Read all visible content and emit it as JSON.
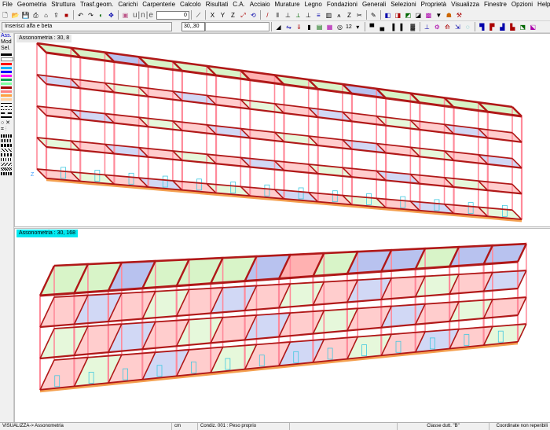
{
  "menu": [
    "File",
    "Geometria",
    "Struttura",
    "Trasf.geom.",
    "Carichi",
    "Carpenterie",
    "Calcolo",
    "Risultati",
    "C.A.",
    "Acciaio",
    "Murature",
    "Legno",
    "Fondazioni",
    "Generali",
    "Selezioni",
    "Proprietà",
    "Visualizza",
    "Finestre",
    "Opzioni",
    "Help"
  ],
  "toolbar": {
    "ortho_label": "u|n|e",
    "count_value": "0",
    "prompt_label": "Inserisci alfa e beta",
    "prompt_value": "30,,30",
    "line_weight_value": "12"
  },
  "left_panel": {
    "ass_label": "Ass.",
    "mod_label": "Mod",
    "sel_label": "Sel.",
    "colors": [
      "#000000",
      "#ffffff",
      "#ff0000",
      "#00b4ff",
      "#0000ff",
      "#ff00ff",
      "#00a050",
      "#80ffa0",
      "#a00000",
      "#ff8080",
      "#ffa040",
      "#ffd0a0"
    ]
  },
  "views": {
    "top": {
      "label": "Assonometria : 30, 8",
      "axis": "Z"
    },
    "bottom": {
      "label": "Assonometria : 30, 168"
    }
  },
  "status": {
    "mode": "VISUALIZZA-> Assonometria",
    "unit": "cm",
    "condition": "Condiz. 001 : Peso proprio",
    "ductility": "Classe dutt. \"B\"",
    "coords": "Coordinate non reperibili"
  },
  "style": {
    "beam_red": "#b01818",
    "frame_pink": "#ff8a9a",
    "slab_green": "#c8f0b0",
    "slab_blue": "#9aa8e8",
    "slab_red": "#ff9090",
    "base_orange": "#f4a050",
    "cyan_line": "#40c8e0",
    "active_label": "#00e8f0"
  }
}
